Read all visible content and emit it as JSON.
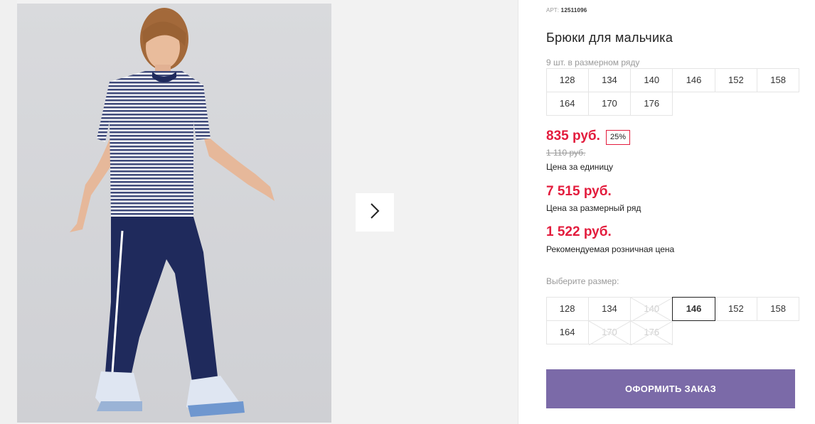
{
  "product": {
    "art_label": "АРТ:",
    "art_number": "12511096",
    "title": "Брюки для мальчика",
    "row_count": "9 шт. в размерном ряду",
    "row_sizes": [
      "128",
      "134",
      "140",
      "146",
      "152",
      "158",
      "164",
      "170",
      "176"
    ]
  },
  "prices": {
    "unit_price": "835 руб.",
    "discount": "25%",
    "old_price": "1 110 руб.",
    "unit_label": "Цена за единицу",
    "row_price": "7 515 руб.",
    "row_label": "Цена за размерный ряд",
    "retail_price": "1 522 руб.",
    "retail_label": "Рекомендуемая розничная цена"
  },
  "size_picker": {
    "label": "Выберите размер:",
    "sizes": [
      {
        "label": "128",
        "state": "available"
      },
      {
        "label": "134",
        "state": "available"
      },
      {
        "label": "140",
        "state": "disabled"
      },
      {
        "label": "146",
        "state": "selected"
      },
      {
        "label": "152",
        "state": "available"
      },
      {
        "label": "158",
        "state": "available"
      },
      {
        "label": "164",
        "state": "available"
      },
      {
        "label": "170",
        "state": "disabled"
      },
      {
        "label": "176",
        "state": "disabled"
      }
    ]
  },
  "order_button": "ОФОРМИТЬ ЗАКАЗ",
  "gallery": {
    "next_icon": "chevron-right-icon"
  },
  "colors": {
    "price_red": "#e31c3d",
    "button_purple": "#7b6aa8"
  }
}
